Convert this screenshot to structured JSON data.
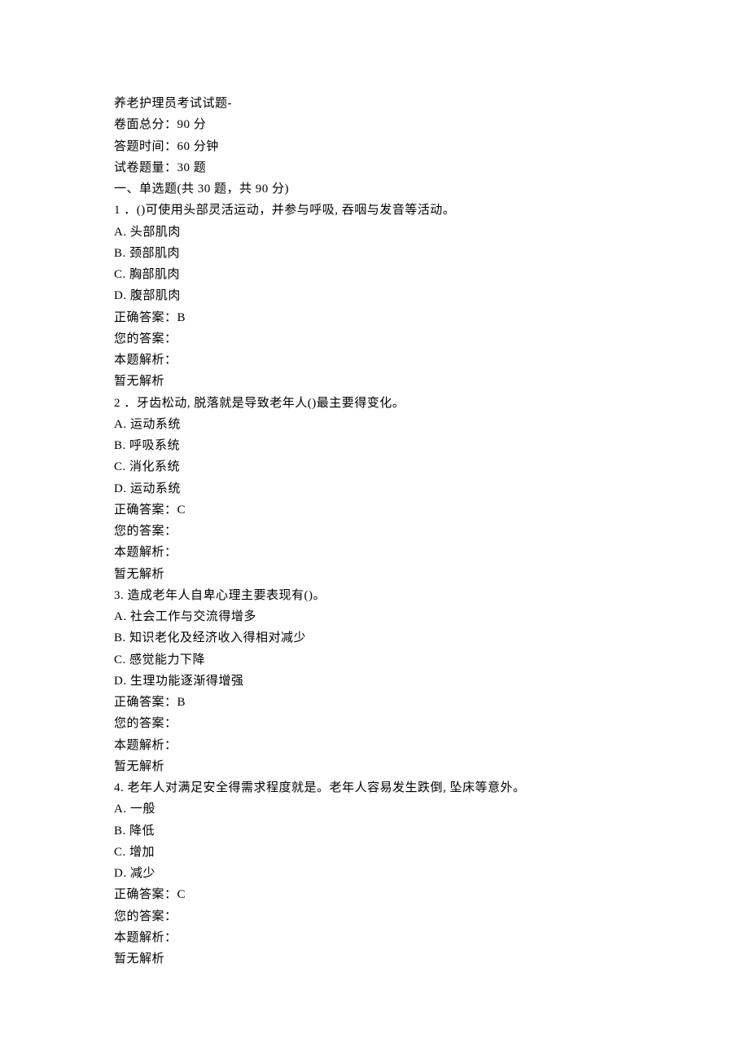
{
  "header": {
    "title": "养老护理员考试试题-",
    "total_score": "卷面总分：90 分",
    "time_limit": "答题时间：60 分钟",
    "question_count": "试卷题量：30 题"
  },
  "section_title": "一、单选题(共 30 题，共 90 分)",
  "questions": [
    {
      "number": "1 ．",
      "stem": "()可使用头部灵活运动，并参与呼吸, 吞咽与发音等活动。",
      "options": [
        "A. 头部肌肉",
        "B. 颈部肌肉",
        "C. 胸部肌肉",
        "D. 腹部肌肉"
      ],
      "correct_answer": "正确答案：B",
      "your_answer": "您的答案：",
      "analysis_label": "本题解析：",
      "analysis_content": "暂无解析"
    },
    {
      "number": "2 ．",
      "stem": "牙齿松动, 脱落就是导致老年人()最主要得变化。",
      "options": [
        "A. 运动系统",
        "B. 呼吸系统",
        "C. 消化系统",
        "D. 运动系统"
      ],
      "correct_answer": "正确答案：C",
      "your_answer": "您的答案：",
      "analysis_label": "本题解析：",
      "analysis_content": "暂无解析"
    },
    {
      "number": "3. ",
      "stem": "造成老年人自卑心理主要表现有()。",
      "options": [
        "A. 社会工作与交流得增多",
        "B. 知识老化及经济收入得相对减少",
        "C. 感觉能力下降",
        "D. 生理功能逐渐得增强"
      ],
      "correct_answer": "正确答案：B",
      "your_answer": "您的答案：",
      "analysis_label": "本题解析：",
      "analysis_content": "暂无解析"
    },
    {
      "number": "4. ",
      "stem": "老年人对满足安全得需求程度就是。老年人容易发生跌倒, 坠床等意外。",
      "options": [
        "A. 一般",
        "B. 降低",
        "C. 增加",
        "D. 减少"
      ],
      "correct_answer": "正确答案：C",
      "your_answer": "您的答案：",
      "analysis_label": "本题解析：",
      "analysis_content": "暂无解析"
    }
  ]
}
